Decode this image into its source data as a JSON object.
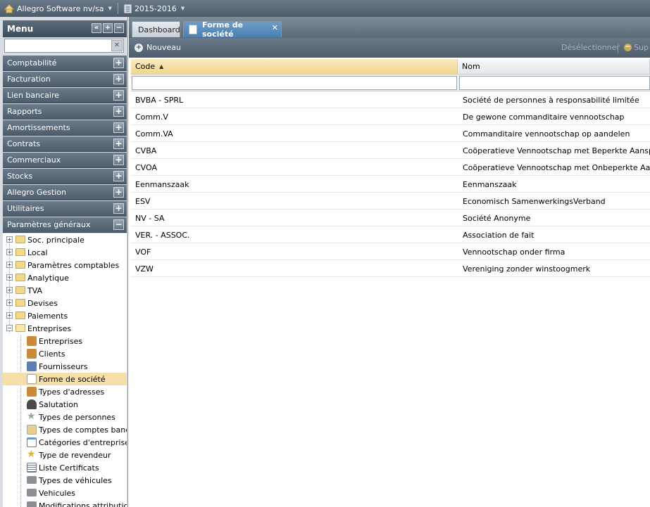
{
  "topbar": {
    "company": "Allegro Software nv/sa",
    "year": "2015-2016"
  },
  "menu": {
    "title": "Menu",
    "search_value": "",
    "categories": [
      {
        "label": "Comptabilité",
        "expanded": false
      },
      {
        "label": "Facturation",
        "expanded": false
      },
      {
        "label": "Lien bancaire",
        "expanded": false
      },
      {
        "label": "Rapports",
        "expanded": false
      },
      {
        "label": "Amortissements",
        "expanded": false
      },
      {
        "label": "Contrats",
        "expanded": false
      },
      {
        "label": "Commerciaux",
        "expanded": false
      },
      {
        "label": "Stocks",
        "expanded": false
      },
      {
        "label": "Allegro Gestion",
        "expanded": false
      },
      {
        "label": "Utilitaires",
        "expanded": false
      },
      {
        "label": "Paramètres généraux",
        "expanded": true
      }
    ],
    "tree": {
      "folders": [
        {
          "label": "Soc. principale"
        },
        {
          "label": "Local"
        },
        {
          "label": "Paramètres comptables"
        },
        {
          "label": "Analytique"
        },
        {
          "label": "TVA"
        },
        {
          "label": "Devises"
        },
        {
          "label": "Paiements"
        },
        {
          "label": "Entreprises"
        }
      ],
      "leaves": [
        {
          "label": "Entreprises",
          "icon": "house-icon",
          "color": "#c98a3a"
        },
        {
          "label": "Clients",
          "icon": "house-icon",
          "color": "#c98a3a"
        },
        {
          "label": "Fournisseurs",
          "icon": "supplier-icon",
          "color": "#5a7fb0"
        },
        {
          "label": "Forme de société",
          "icon": "document-icon",
          "color": "#cfd8e0"
        },
        {
          "label": "Types d'adresses",
          "icon": "house-icon",
          "color": "#c98a3a"
        },
        {
          "label": "Salutation",
          "icon": "person-icon",
          "color": "#4a4a4a"
        },
        {
          "label": "Types de personnes",
          "icon": "star-icon",
          "color": "#b8c2cc"
        },
        {
          "label": "Types de comptes banca",
          "icon": "bank-card-icon",
          "color": "#d8b65a"
        },
        {
          "label": "Catégories d'entreprise",
          "icon": "window-icon",
          "color": "#d0dae3"
        },
        {
          "label": "Type de revendeur",
          "icon": "trophy-icon",
          "color": "#e0b23a"
        },
        {
          "label": "Liste Certificats",
          "icon": "list-icon",
          "color": "#dfe4e8"
        },
        {
          "label": "Types de véhicules",
          "icon": "truck-icon",
          "color": "#8a8f96"
        },
        {
          "label": "Vehicules",
          "icon": "truck-icon",
          "color": "#8a8f96"
        },
        {
          "label": "Modifications attributions",
          "icon": "truck-icon",
          "color": "#8a8f96"
        }
      ],
      "selected": "Forme de société"
    }
  },
  "tabs": [
    {
      "label": "Dashboard",
      "active": false
    },
    {
      "label": "Forme de société",
      "active": true
    }
  ],
  "toolbar": {
    "new_label": "Nouveau",
    "deselect_label": "Désélectionner",
    "delete_label": "Sup"
  },
  "grid": {
    "columns": [
      {
        "label": "Code",
        "sorted": "asc"
      },
      {
        "label": "Nom"
      }
    ],
    "filter_code": "",
    "filter_nom": "",
    "rows": [
      {
        "code": "BVBA - SPRL",
        "nom": "Société de personnes à responsabilité limitée"
      },
      {
        "code": "Comm.V",
        "nom": "De gewone commanditaire vennootschap"
      },
      {
        "code": "Comm.VA",
        "nom": "Commanditaire vennootschap op aandelen"
      },
      {
        "code": "CVBA",
        "nom": "Coöperatieve Vennootschap met Beperkte Aansprakel"
      },
      {
        "code": "CVOA",
        "nom": "Coöperatieve Vennootschap met Onbeperkte Aanspra"
      },
      {
        "code": "Eenmanszaak",
        "nom": "Eenmanszaak"
      },
      {
        "code": "ESV",
        "nom": "Economisch SamenwerkingsVerband"
      },
      {
        "code": "NV - SA",
        "nom": "Société Anonyme"
      },
      {
        "code": "VER. - ASSOC.",
        "nom": "Association de fait"
      },
      {
        "code": "VOF",
        "nom": "Vennootschap onder firma"
      },
      {
        "code": "VZW",
        "nom": "Vereniging zonder winstoogmerk"
      }
    ]
  }
}
